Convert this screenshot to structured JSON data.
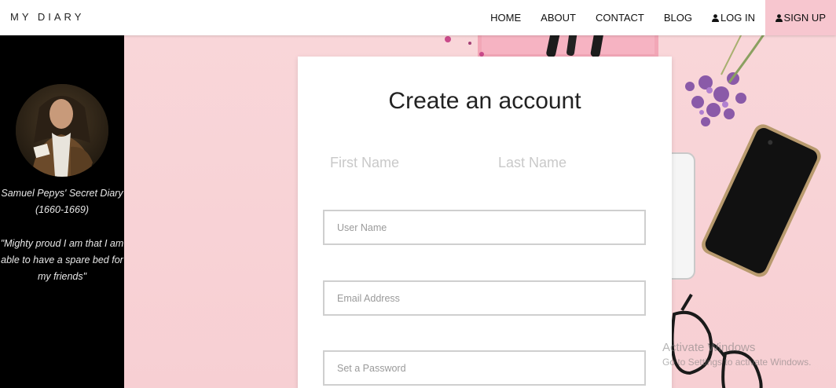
{
  "header": {
    "brand": "MY DIARY",
    "nav": [
      {
        "label": "HOME"
      },
      {
        "label": "ABOUT"
      },
      {
        "label": "CONTACT"
      },
      {
        "label": "BLOG"
      },
      {
        "label": "LOG IN",
        "icon": "user-icon"
      },
      {
        "label": "SIGN UP",
        "icon": "user-icon"
      }
    ],
    "signup_bg": "#f7c6cf"
  },
  "sidebar": {
    "title_line1": "Samuel Pepys' Secret Diary",
    "title_line2": "(1660-1669)",
    "quote_line1": "\"Mighty proud I am that I am",
    "quote_line2": "able to have a spare bed for",
    "quote_line3": "my friends\""
  },
  "form": {
    "heading": "Create an account",
    "first_name_placeholder": "First Name",
    "last_name_placeholder": "Last Name",
    "username_placeholder": "User Name",
    "email_placeholder": "Email Address",
    "password_placeholder": "Set a Password"
  },
  "watermark": {
    "line1": "Activate Windows",
    "line2": "Go to Settings to activate Windows."
  }
}
